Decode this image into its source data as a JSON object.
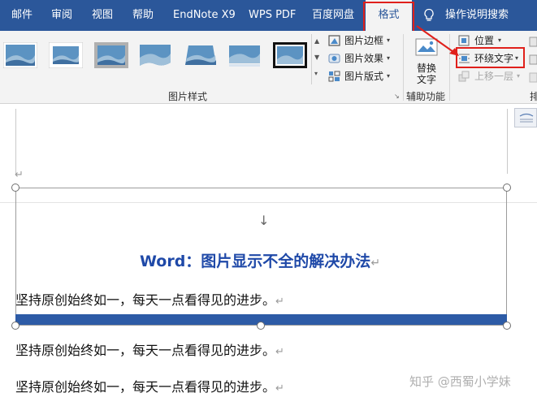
{
  "tabs": [
    {
      "label": "邮件"
    },
    {
      "label": "审阅"
    },
    {
      "label": "视图"
    },
    {
      "label": "帮助"
    },
    {
      "label": "EndNote X9"
    },
    {
      "label": "WPS PDF"
    },
    {
      "label": "百度网盘"
    },
    {
      "label": "格式"
    },
    {
      "label": "操作说明搜索"
    }
  ],
  "ribbon": {
    "picture_styles": {
      "label": "图片样式",
      "border": "图片边框",
      "effects": "图片效果",
      "layout": "图片版式"
    },
    "accessibility": {
      "alt_text_line1": "替换",
      "alt_text_line2": "文字",
      "label": "辅助功能"
    },
    "arrange": {
      "position": "位置",
      "wrap_text": "环绕文字",
      "bring_forward": "上移一层",
      "label_partial": "排"
    }
  },
  "document": {
    "title": "Word：图片显示不全的解决办法",
    "lines": [
      "坚持原创始终如一，每天一点看得见的进步。",
      "坚持原创始终如一，每天一点看得见的进步。",
      "坚持原创始终如一，每天一点看得见的进步。"
    ],
    "arrow": "↓",
    "para_mark": "↵"
  },
  "watermark": "知乎 @西蜀小学妹",
  "colors": {
    "tab_bar": "#2b579a",
    "ribbon": "#f3f3f3",
    "highlight": "#e0201b",
    "title_blue": "#1f49a8",
    "bar_blue": "#2d5ba6"
  }
}
